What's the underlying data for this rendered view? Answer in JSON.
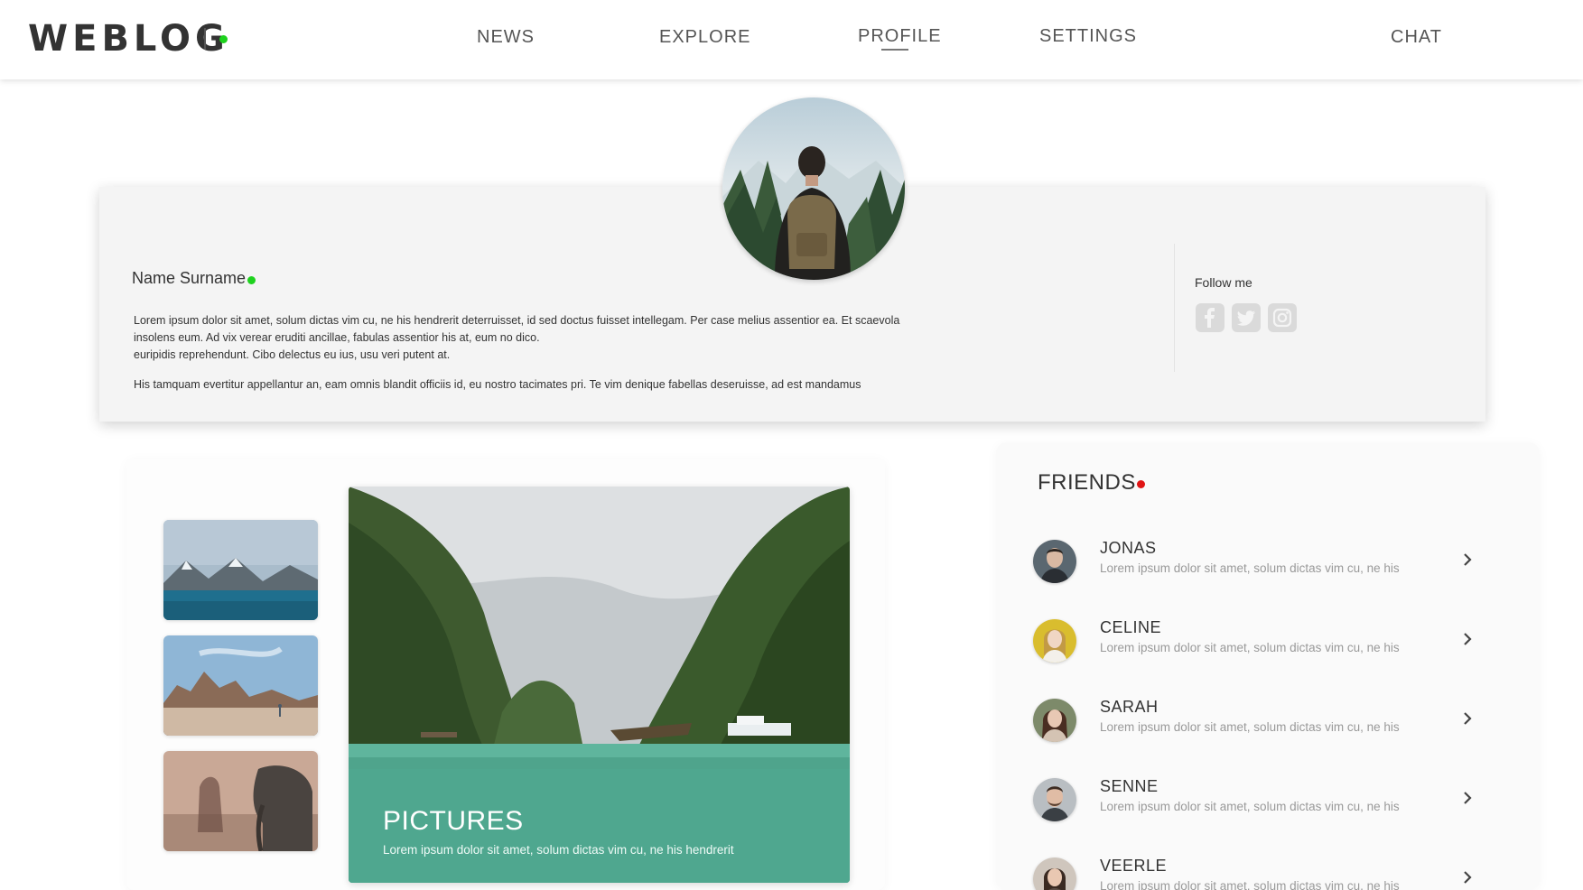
{
  "header": {
    "logo": "WEBLOG",
    "nav": [
      "NEWS",
      "EXPLORE",
      "PROFILE",
      "SETTINGS",
      "CHAT"
    ],
    "active_nav": "PROFILE",
    "status_color": "#1ed21e"
  },
  "profile": {
    "name": "Name Surname",
    "bio_line1": "Lorem ipsum dolor sit amet, solum dictas vim cu, ne his hendrerit deterruisset, id sed doctus fuisset intellegam. Per case melius assentior ea. Et scaevola insolens eum. Ad vix verear eruditi ancillae, fabulas assentior his at, eum no dico.",
    "bio_line2": "euripidis reprehendunt. Cibo delectus eu ius, usu veri putent at.",
    "bio_para2": "His tamquam evertitur appellantur an, eam omnis blandit officiis id, eu nostro tacimates pri. Te vim denique fabellas deseruisse, ad est mandamus",
    "follow_label": "Follow me",
    "social_icons": [
      "facebook-icon",
      "twitter-icon",
      "instagram-icon"
    ]
  },
  "gallery": {
    "title": "PICTURES",
    "subtitle": "Lorem ipsum dolor sit amet, solum dictas vim cu, ne his hendrerit"
  },
  "friends": {
    "title": "FRIENDS",
    "indicator_color": "#e01414",
    "items": [
      {
        "name": "JONAS",
        "desc": "Lorem ipsum dolor sit amet, solum dictas vim cu, ne his"
      },
      {
        "name": "CELINE",
        "desc": "Lorem ipsum dolor sit amet, solum dictas vim cu, ne his"
      },
      {
        "name": "SARAH",
        "desc": "Lorem ipsum dolor sit amet, solum dictas vim cu, ne his"
      },
      {
        "name": "SENNE",
        "desc": "Lorem ipsum dolor sit amet, solum dictas vim cu, ne his"
      },
      {
        "name": "VEERLE",
        "desc": "Lorem ipsum dolor sit amet, solum dictas vim cu, ne his"
      }
    ]
  }
}
